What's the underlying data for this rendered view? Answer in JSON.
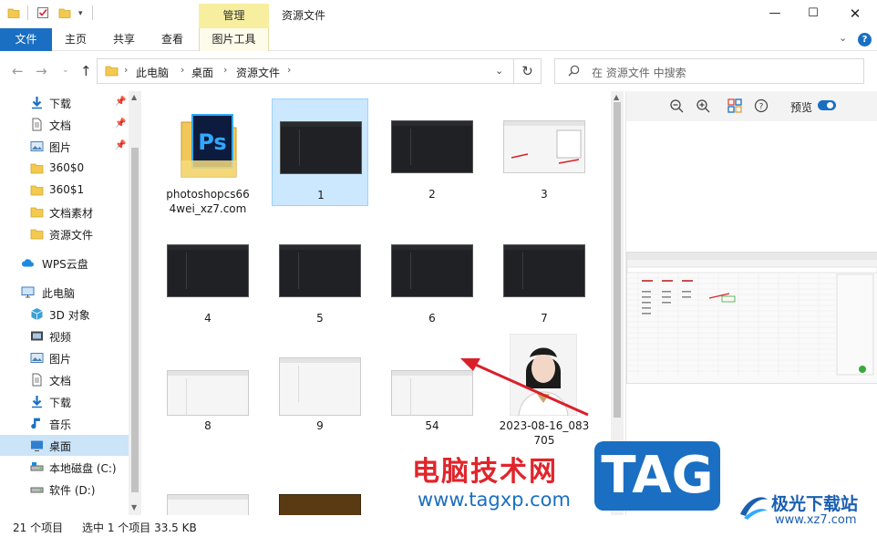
{
  "window": {
    "title": "资源文件",
    "context_tab": "管理",
    "min_glyph": "—",
    "max_glyph": "☐",
    "close_glyph": "✕"
  },
  "ribbon": {
    "tabs": [
      "文件",
      "主页",
      "共享",
      "查看",
      "图片工具"
    ],
    "help_glyph": "?"
  },
  "address": {
    "breadcrumbs": [
      "此电脑",
      "桌面",
      "资源文件"
    ],
    "search_placeholder": "在 资源文件 中搜索"
  },
  "sidebar": {
    "items": [
      {
        "label": "下载",
        "icon": "download-arrow-icon",
        "pinned": true
      },
      {
        "label": "文档",
        "icon": "document-icon",
        "pinned": true
      },
      {
        "label": "图片",
        "icon": "picture-icon",
        "pinned": true
      },
      {
        "label": "360$0",
        "icon": "folder-icon",
        "pinned": false
      },
      {
        "label": "360$1",
        "icon": "folder-icon",
        "pinned": false
      },
      {
        "label": "文档素材",
        "icon": "folder-icon",
        "pinned": false
      },
      {
        "label": "资源文件",
        "icon": "folder-icon",
        "pinned": false
      },
      {
        "label": "WPS云盘",
        "icon": "cloud-icon",
        "pinned": false
      },
      {
        "label": "此电脑",
        "icon": "computer-icon",
        "pinned": false
      },
      {
        "label": "3D 对象",
        "icon": "cube-3d-icon",
        "pinned": false
      },
      {
        "label": "视频",
        "icon": "video-icon",
        "pinned": false
      },
      {
        "label": "图片",
        "icon": "picture-icon",
        "pinned": false
      },
      {
        "label": "文档",
        "icon": "document-icon",
        "pinned": false
      },
      {
        "label": "下载",
        "icon": "download-arrow-icon",
        "pinned": false
      },
      {
        "label": "音乐",
        "icon": "music-note-icon",
        "pinned": false
      },
      {
        "label": "桌面",
        "icon": "desktop-icon",
        "pinned": false
      },
      {
        "label": "本地磁盘 (C:)",
        "icon": "drive-icon",
        "pinned": false
      },
      {
        "label": "软件 (D:)",
        "icon": "drive-icon",
        "pinned": false
      }
    ]
  },
  "files": [
    {
      "label": "photoshopcs664wei_xz7.com",
      "line1": "photoshopcs66",
      "line2": "4wei_xz7.com",
      "kind": "ps-folder"
    },
    {
      "label": "1",
      "kind": "dark"
    },
    {
      "label": "2",
      "kind": "dark"
    },
    {
      "label": "3",
      "kind": "light"
    },
    {
      "label": "4",
      "kind": "dark"
    },
    {
      "label": "5",
      "kind": "dark"
    },
    {
      "label": "6",
      "kind": "dark"
    },
    {
      "label": "7",
      "kind": "dark"
    },
    {
      "label": "8",
      "kind": "light"
    },
    {
      "label": "9",
      "kind": "light"
    },
    {
      "label": "54",
      "kind": "light"
    },
    {
      "label": "2023-08-16_083705",
      "line1": "2023-08-16_083",
      "line2": "705",
      "kind": "photo"
    }
  ],
  "preview": {
    "label": "预览"
  },
  "status": {
    "count": "21 个项目",
    "selection": "选中 1 个项目  33.5 KB"
  },
  "watermarks": {
    "site_cn": "电脑技术网",
    "site_url": "www.tagxp.com",
    "tag": "TAG",
    "jg_name": "极光下载站",
    "jg_url": "www.xz7.com"
  },
  "colors": {
    "accent": "#1a6fc2",
    "selection": "#cce8ff",
    "context_tab": "#f7ef9f",
    "annotation_arrow": "#d9202a"
  }
}
